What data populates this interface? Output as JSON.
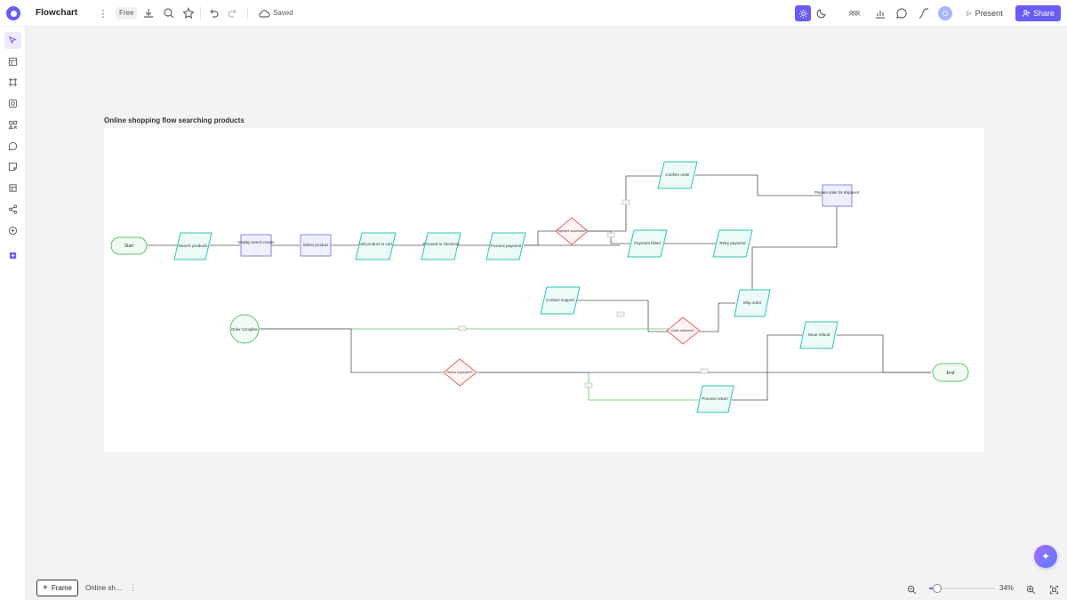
{
  "app": {
    "title": "Flowchart",
    "plan_badge": "Free",
    "save_status": "Saved"
  },
  "toolbar": {
    "present_label": "Present",
    "share_label": "Share",
    "avatar_initial": "O"
  },
  "frame": {
    "title": "Online shopping flow searching products"
  },
  "bottom": {
    "frame_button": "Frame",
    "page_tab": "Online sh…",
    "zoom": "34%",
    "zoom_fraction": 0.34
  },
  "colors": {
    "accent": "#6a5cf6",
    "process_stroke": "#2ec4b6",
    "process_fill": "#ecfbf8",
    "decision_stroke": "#e05b5b",
    "decision_fill": "#fff3f3",
    "rect_stroke": "#6b6fd6",
    "rect_fill": "#eef0ff",
    "terminal_stroke": "#5cc46a",
    "terminal_fill": "#f1fbf2"
  },
  "nodes": [
    {
      "id": "start",
      "label": "Start",
      "shape": "terminal"
    },
    {
      "id": "search",
      "label": "Search products",
      "shape": "parallelogram"
    },
    {
      "id": "display",
      "label": "Display search results",
      "shape": "rect"
    },
    {
      "id": "select",
      "label": "Select product",
      "shape": "rect"
    },
    {
      "id": "addcart",
      "label": "Add product to cart",
      "shape": "parallelogram"
    },
    {
      "id": "checkout",
      "label": "Proceed to checkout",
      "shape": "parallelogram"
    },
    {
      "id": "payment",
      "label": "Process payment",
      "shape": "parallelogram"
    },
    {
      "id": "paysuccess",
      "label": "Payment successful?",
      "shape": "diamond"
    },
    {
      "id": "confirm",
      "label": "Confirm order",
      "shape": "parallelogram"
    },
    {
      "id": "prepare",
      "label": "Prepare order for shipment",
      "shape": "rect"
    },
    {
      "id": "payfailed",
      "label": "Payment failed",
      "shape": "parallelogram"
    },
    {
      "id": "retry",
      "label": "Retry payment",
      "shape": "parallelogram"
    },
    {
      "id": "ship",
      "label": "Ship order",
      "shape": "parallelogram"
    },
    {
      "id": "contact",
      "label": "Contact support",
      "shape": "parallelogram"
    },
    {
      "id": "delivered",
      "label": "Order delivered?",
      "shape": "diamond"
    },
    {
      "id": "complete",
      "label": "Order Complete",
      "shape": "terminal-circle"
    },
    {
      "id": "returnreq",
      "label": "Return requested?",
      "shape": "diamond"
    },
    {
      "id": "refund",
      "label": "Issue refund",
      "shape": "parallelogram"
    },
    {
      "id": "processreturn",
      "label": "Process return",
      "shape": "parallelogram"
    },
    {
      "id": "end",
      "label": "End",
      "shape": "terminal"
    }
  ],
  "edge_labels": [
    "Yes",
    "No",
    "No",
    "Yes",
    "No",
    "Yes"
  ]
}
